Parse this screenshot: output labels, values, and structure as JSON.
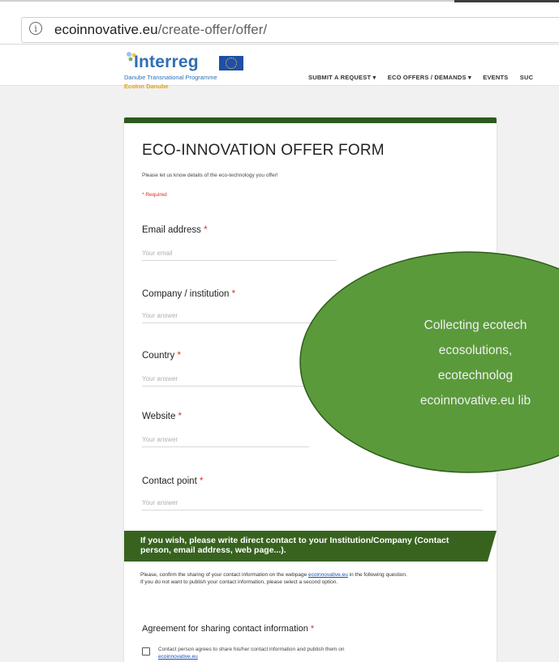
{
  "browser": {
    "url_domain": "ecoinnovative.eu",
    "url_path": "/create-offer/offer/"
  },
  "header": {
    "logo_title": "Interreg",
    "logo_line1": "Danube Transnational Programme",
    "logo_line2": "EcoInn Danube",
    "nav_items": [
      "SUBMIT A REQUEST ▾",
      "ECO OFFERS / DEMANDS ▾",
      "EVENTS",
      "SUC"
    ]
  },
  "form": {
    "title": "ECO-INNOVATION OFFER FORM",
    "description": "Please let us know details of the eco-technology you offer!",
    "required_note": "* Required",
    "fields": [
      {
        "label": "Email address",
        "placeholder": "Your email"
      },
      {
        "label": "Company / institution",
        "placeholder": "Your answer"
      },
      {
        "label": "Country",
        "placeholder": "Your answer"
      },
      {
        "label": "Website",
        "placeholder": "Your answer"
      },
      {
        "label": "Contact point",
        "placeholder": "Your answer"
      }
    ],
    "required_star": "*",
    "banner_text": "If you wish, please write direct contact to your Institution/Company (Contact person, email address, web page...).",
    "confirm_text_1": "Please, confirm the sharing of your contact information on the webpage",
    "confirm_link": "ecoinnovative.eu",
    "confirm_text_2": "in the following question.",
    "confirm_text_3": "If you do not want to publish your contact information, please select a second option.",
    "agreement_label": "Agreement for sharing contact information",
    "checkbox_text": "Contact person agrees to share his/her contact information and publish them on",
    "checkbox_link": "ecoinnovative.eu"
  },
  "callout": {
    "lines": [
      "Collecting ecotech",
      "ecosolutions,",
      "ecotechnolog",
      "ecoinnovative.eu lib"
    ],
    "fill_color": "#5a9a3b"
  },
  "colors": {
    "card_accent": "#2e5a1f",
    "banner": "#37631f",
    "required": "#d93025",
    "link": "#1a4fb5"
  }
}
